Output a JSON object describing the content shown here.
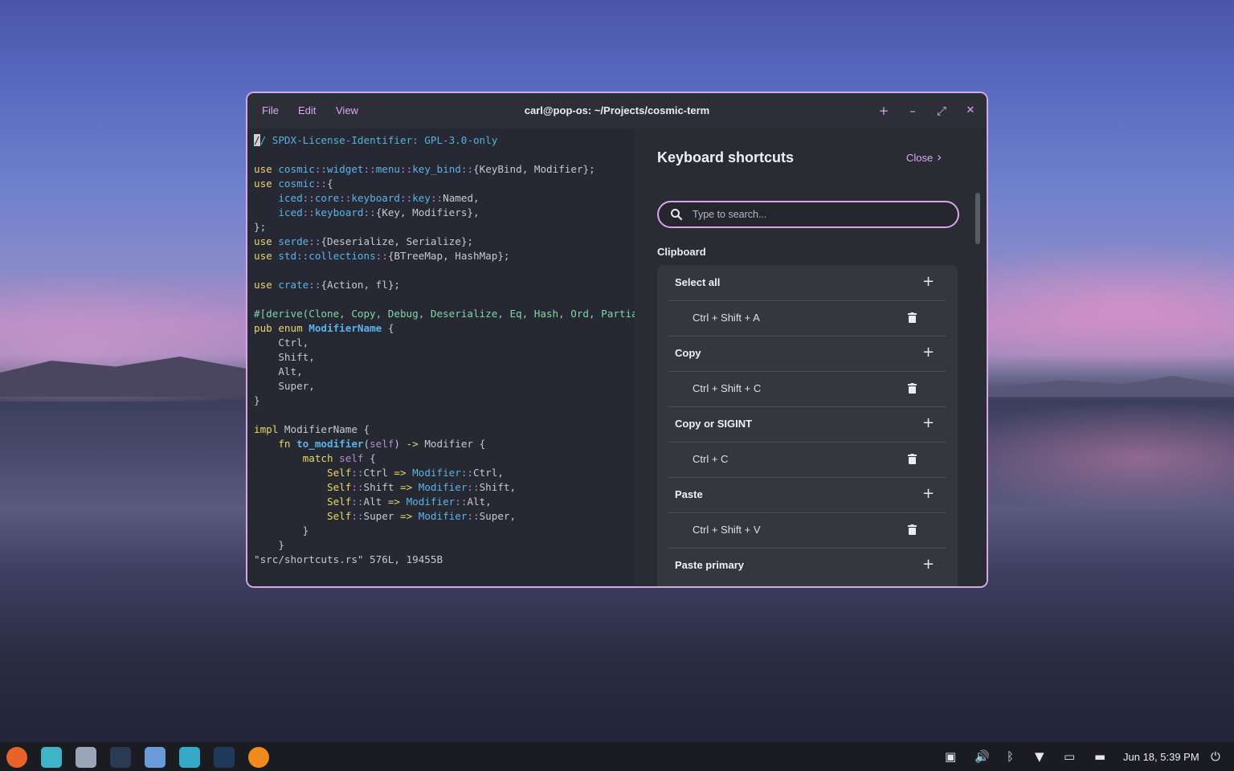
{
  "window": {
    "title": "carl@pop-os: ~/Projects/cosmic-term",
    "menu": [
      "File",
      "Edit",
      "View"
    ],
    "controls": {
      "new_tab": "+",
      "minimize": "–",
      "maximize": "⤢",
      "close": "✕"
    }
  },
  "terminal": {
    "lines": [
      [
        {
          "t": "/",
          "c": "cursor"
        },
        {
          "t": "/ SPDX-License-Identifier: GPL-3.0-only",
          "c": "cm"
        }
      ],
      [],
      [
        {
          "t": "use ",
          "c": "kw"
        },
        {
          "t": "cosmic",
          "c": "ns"
        },
        {
          "t": "::",
          "c": "op"
        },
        {
          "t": "widget",
          "c": "ns"
        },
        {
          "t": "::",
          "c": "op"
        },
        {
          "t": "menu",
          "c": "ns"
        },
        {
          "t": "::",
          "c": "op"
        },
        {
          "t": "key_bind",
          "c": "ns"
        },
        {
          "t": "::",
          "c": "op"
        },
        {
          "t": "{KeyBind, Modifier};",
          "c": ""
        }
      ],
      [
        {
          "t": "use ",
          "c": "kw"
        },
        {
          "t": "cosmic",
          "c": "ns"
        },
        {
          "t": "::",
          "c": "op"
        },
        {
          "t": "{",
          "c": ""
        }
      ],
      [
        {
          "t": "    iced",
          "c": "ns"
        },
        {
          "t": "::",
          "c": "op"
        },
        {
          "t": "core",
          "c": "ns"
        },
        {
          "t": "::",
          "c": "op"
        },
        {
          "t": "keyboard",
          "c": "ns"
        },
        {
          "t": "::",
          "c": "op"
        },
        {
          "t": "key",
          "c": "ns"
        },
        {
          "t": "::",
          "c": "op"
        },
        {
          "t": "Named,",
          "c": ""
        }
      ],
      [
        {
          "t": "    iced",
          "c": "ns"
        },
        {
          "t": "::",
          "c": "op"
        },
        {
          "t": "keyboard",
          "c": "ns"
        },
        {
          "t": "::",
          "c": "op"
        },
        {
          "t": "{Key, Modifiers},",
          "c": ""
        }
      ],
      [
        {
          "t": "};",
          "c": ""
        }
      ],
      [
        {
          "t": "use ",
          "c": "kw"
        },
        {
          "t": "serde",
          "c": "ns"
        },
        {
          "t": "::",
          "c": "op"
        },
        {
          "t": "{Deserialize, Serialize};",
          "c": ""
        }
      ],
      [
        {
          "t": "use ",
          "c": "kw"
        },
        {
          "t": "std",
          "c": "ns"
        },
        {
          "t": "::",
          "c": "op"
        },
        {
          "t": "collections",
          "c": "ns"
        },
        {
          "t": "::",
          "c": "op"
        },
        {
          "t": "{BTreeMap, HashMap};",
          "c": ""
        }
      ],
      [],
      [
        {
          "t": "use ",
          "c": "kw"
        },
        {
          "t": "crate",
          "c": "ns"
        },
        {
          "t": "::",
          "c": "op"
        },
        {
          "t": "{Action, fl};",
          "c": ""
        }
      ],
      [],
      [
        {
          "t": "#[derive(Clone, Copy, Debug, Deserialize, Eq, Hash, Ord, Partia",
          "c": "mc"
        }
      ],
      [
        {
          "t": "pub enum ",
          "c": "kw"
        },
        {
          "t": "ModifierName",
          "c": "ty"
        },
        {
          "t": " {",
          "c": ""
        }
      ],
      [
        {
          "t": "    Ctrl,",
          "c": ""
        }
      ],
      [
        {
          "t": "    Shift,",
          "c": ""
        }
      ],
      [
        {
          "t": "    Alt,",
          "c": ""
        }
      ],
      [
        {
          "t": "    Super,",
          "c": ""
        }
      ],
      [
        {
          "t": "}",
          "c": ""
        }
      ],
      [],
      [
        {
          "t": "impl ",
          "c": "kw"
        },
        {
          "t": "ModifierName {",
          "c": ""
        }
      ],
      [
        {
          "t": "    fn ",
          "c": "kw"
        },
        {
          "t": "to_modifier",
          "c": "ty"
        },
        {
          "t": "(",
          "c": ""
        },
        {
          "t": "self",
          "c": "op"
        },
        {
          "t": ") ",
          "c": ""
        },
        {
          "t": "->",
          "c": "kw"
        },
        {
          "t": " Modifier {",
          "c": ""
        }
      ],
      [
        {
          "t": "        match ",
          "c": "kw"
        },
        {
          "t": "self",
          "c": "op"
        },
        {
          "t": " {",
          "c": ""
        }
      ],
      [
        {
          "t": "            Self",
          "c": "kw"
        },
        {
          "t": "::",
          "c": "op"
        },
        {
          "t": "Ctrl ",
          "c": ""
        },
        {
          "t": "=>",
          "c": "kw"
        },
        {
          "t": " Modifier",
          "c": "ns"
        },
        {
          "t": "::",
          "c": "op"
        },
        {
          "t": "Ctrl,",
          "c": ""
        }
      ],
      [
        {
          "t": "            Self",
          "c": "kw"
        },
        {
          "t": "::",
          "c": "op"
        },
        {
          "t": "Shift ",
          "c": ""
        },
        {
          "t": "=>",
          "c": "kw"
        },
        {
          "t": " Modifier",
          "c": "ns"
        },
        {
          "t": "::",
          "c": "op"
        },
        {
          "t": "Shift,",
          "c": ""
        }
      ],
      [
        {
          "t": "            Self",
          "c": "kw"
        },
        {
          "t": "::",
          "c": "op"
        },
        {
          "t": "Alt ",
          "c": ""
        },
        {
          "t": "=>",
          "c": "kw"
        },
        {
          "t": " Modifier",
          "c": "ns"
        },
        {
          "t": "::",
          "c": "op"
        },
        {
          "t": "Alt,",
          "c": ""
        }
      ],
      [
        {
          "t": "            Self",
          "c": "kw"
        },
        {
          "t": "::",
          "c": "op"
        },
        {
          "t": "Super ",
          "c": ""
        },
        {
          "t": "=>",
          "c": "kw"
        },
        {
          "t": " Modifier",
          "c": "ns"
        },
        {
          "t": "::",
          "c": "op"
        },
        {
          "t": "Super,",
          "c": ""
        }
      ],
      [
        {
          "t": "        }",
          "c": ""
        }
      ],
      [
        {
          "t": "    }",
          "c": ""
        }
      ],
      [
        {
          "t": "\"src/shortcuts.rs\" 576L, 19455B",
          "c": ""
        }
      ]
    ]
  },
  "shortcuts_panel": {
    "title": "Keyboard shortcuts",
    "close_label": "Close",
    "search_placeholder": "Type to search...",
    "section": "Clipboard",
    "actions": [
      {
        "name": "Select all",
        "binding": "Ctrl + Shift + A"
      },
      {
        "name": "Copy",
        "binding": "Ctrl + Shift + C"
      },
      {
        "name": "Copy or SIGINT",
        "binding": "Ctrl + C"
      },
      {
        "name": "Paste",
        "binding": "Ctrl + Shift + V"
      },
      {
        "name": "Paste primary",
        "binding": ""
      }
    ]
  },
  "taskbar": {
    "apps": [
      {
        "name": "firefox",
        "color": "#e8622a"
      },
      {
        "name": "files",
        "color": "#3fb4c8"
      },
      {
        "name": "text-editor",
        "color": "#9aa6b8"
      },
      {
        "name": "terminal",
        "color": "#2a3a52"
      },
      {
        "name": "shop",
        "color": "#6a9ad8"
      },
      {
        "name": "settings",
        "color": "#36a8c8"
      },
      {
        "name": "system-monitor",
        "color": "#1f3a5a"
      },
      {
        "name": "app-orange",
        "color": "#f08a1c"
      }
    ],
    "clock": "Jun 18, 5:39 PM"
  },
  "colors": {
    "accent": "#d6a6e8"
  }
}
